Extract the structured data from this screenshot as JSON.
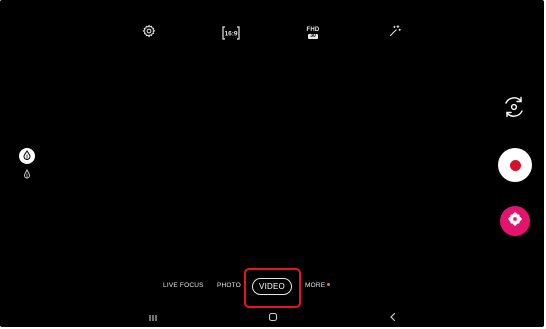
{
  "topbar": {
    "settings_icon": "gear-icon",
    "aspect_ratio_label": "16:9",
    "resolution_label": "FHD",
    "resolution_sub": "30",
    "effects_icon": "sparkle-icon"
  },
  "left_tools": {
    "filter_icon": "drop-filter-icon",
    "sub_icon": "drop-small-icon"
  },
  "right_controls": {
    "switch_camera_icon": "rotate-camera-icon",
    "record_icon": "record-icon",
    "effects_icon": "flower-icon"
  },
  "modes": {
    "live_focus": "LIVE FOCUS",
    "photo": "PHOTO",
    "video": "VIDEO",
    "more": "MORE",
    "selected": "VIDEO"
  },
  "colors": {
    "record": "#d8112a",
    "effects": "#e3136e",
    "highlight": "#e8131b",
    "more_dot": "#ff6a2a"
  },
  "navbar": {
    "recents_icon": "recents-icon",
    "home_icon": "home-icon",
    "back_icon": "back-icon"
  }
}
